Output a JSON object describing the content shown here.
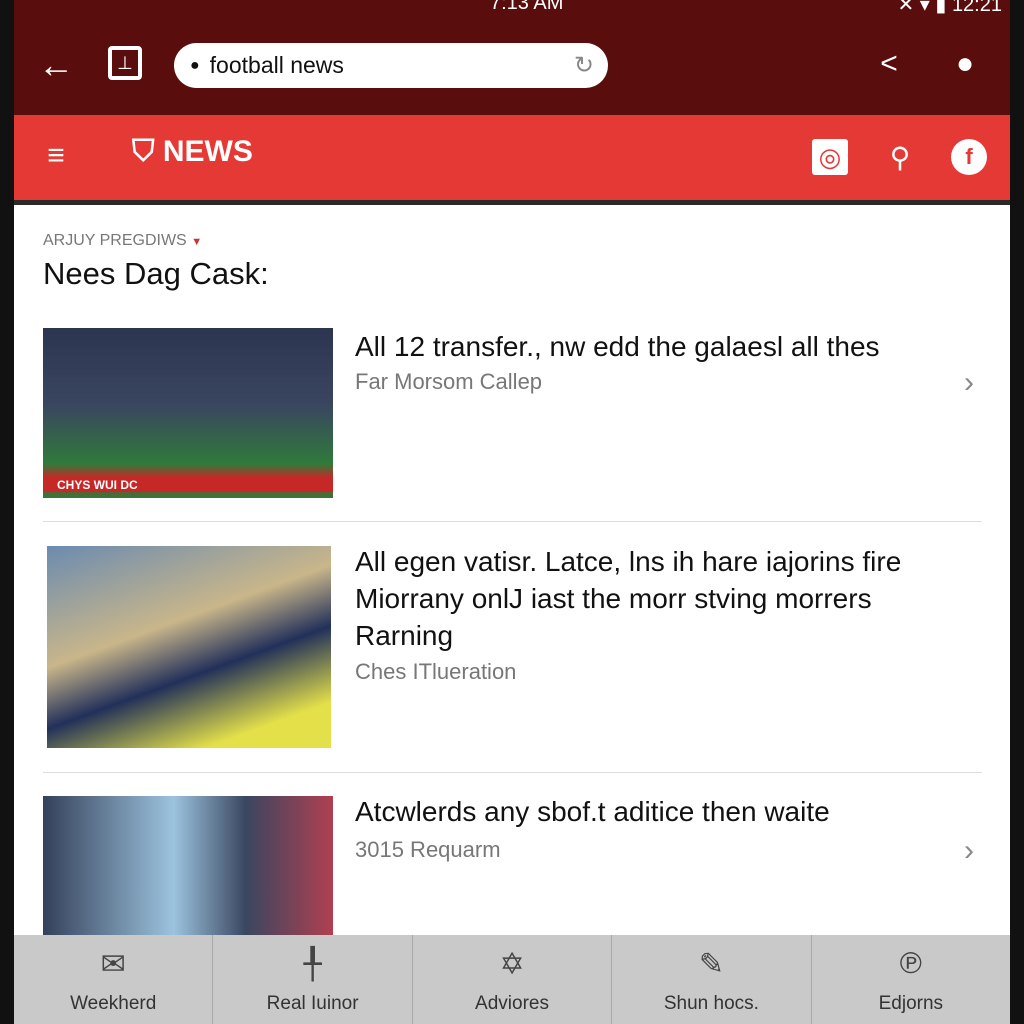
{
  "status_bar": {
    "time_center": "7:13 AM",
    "time_right": "12:21"
  },
  "browser": {
    "url_text": "football news"
  },
  "app": {
    "logo_text": "NEWS",
    "accent": "#e53935",
    "top_color": "#5a0d0d"
  },
  "section": {
    "kicker": "ARJUY PREGDIWS",
    "title": "Nees Dag Cask:"
  },
  "articles": [
    {
      "headline": "All 12 transfer., nw edd the galaesl all thes",
      "source": "Far Morsom Callep",
      "banner": "CHYS WUI DC"
    },
    {
      "headline": "All egen vatisr. Latce, lns ih hare iajorins fire Miorrany onlJ iast the morr stving morrers Rarning",
      "source": "Ches ITlueration"
    },
    {
      "headline": "Atcwlerds any sbof.t aditice then waite",
      "source": "3015 Requarm"
    }
  ],
  "bottom_nav": [
    {
      "label": "Weekherd",
      "icon": "mail-icon"
    },
    {
      "label": "Real Iuinor",
      "icon": "pin-icon"
    },
    {
      "label": "Adviores",
      "icon": "star-badge-icon"
    },
    {
      "label": "Shun hocs.",
      "icon": "edit-icon"
    },
    {
      "label": "Edjorns",
      "icon": "p-icon"
    }
  ]
}
